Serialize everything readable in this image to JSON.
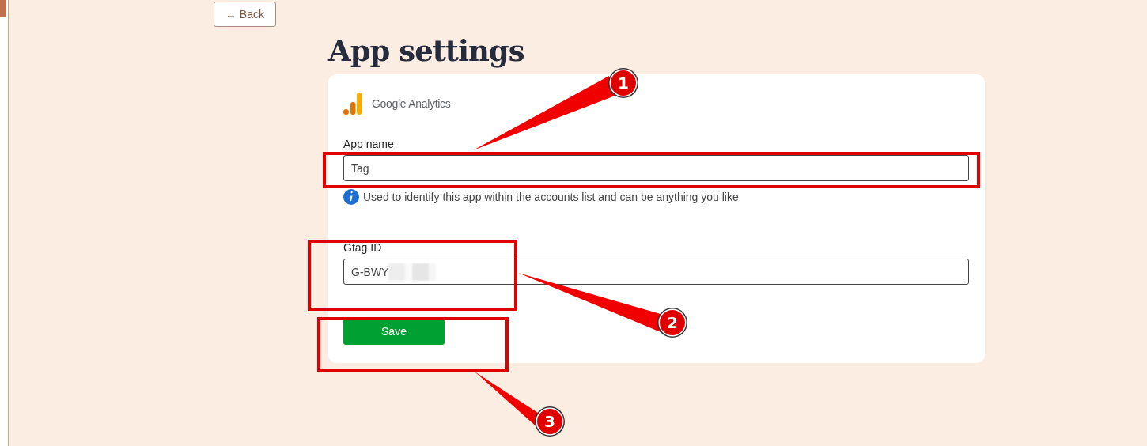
{
  "back_button": {
    "label": "← Back"
  },
  "title": "App settings",
  "card": {
    "brand": "Google Analytics",
    "fields": [
      {
        "label": "App name",
        "value": "Tag",
        "help": "Used to identify this app within the accounts list and can be anything you like",
        "redacted": false
      },
      {
        "label": "Gtag ID",
        "value": "G-BWY",
        "redacted": true
      }
    ],
    "save_button": {
      "label": "Save"
    }
  },
  "annotations": [
    {
      "number": "1"
    },
    {
      "number": "2"
    },
    {
      "number": "3"
    }
  ]
}
